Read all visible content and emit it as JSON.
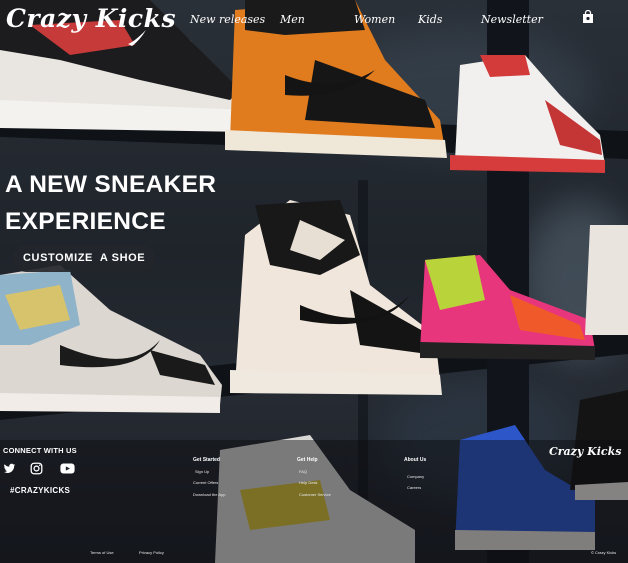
{
  "brand": {
    "name": "Crazy Kicks"
  },
  "nav": {
    "items": [
      "New releases",
      "Men",
      "Women",
      "Kids",
      "Newsletter"
    ],
    "cart_icon": "shopping-bag-icon"
  },
  "hero": {
    "title_line1": "A NEW SNEAKER",
    "title_line2": "EXPERIENCE",
    "cta_label": "CUSTOMIZE  A SHOE"
  },
  "footer": {
    "connect_title": "CONNECT WITH US",
    "social": [
      "twitter-icon",
      "instagram-icon",
      "youtube-icon"
    ],
    "hashtag": "#CRAZYKICKS",
    "columns": [
      {
        "title": "Get Started",
        "links": [
          "Sign Up",
          "Current Offers",
          "Download the App"
        ]
      },
      {
        "title": "Get Help",
        "links": [
          "FAQ",
          "Help Desk",
          "Customer Service"
        ]
      },
      {
        "title": "About Us",
        "links": [
          "Company",
          "Careers"
        ]
      }
    ],
    "logo": "Crazy Kicks",
    "terms": "Terms of Use",
    "privacy": "Privacy Policy",
    "copyright": "© Crazy Kicks"
  }
}
